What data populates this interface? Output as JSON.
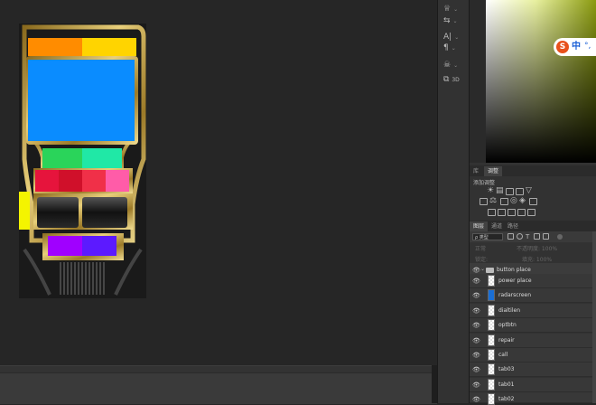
{
  "tool_strip": {
    "tools": [
      {
        "icon": "brush-settings-icon",
        "glyph": "♕"
      },
      {
        "icon": "clone-source-icon",
        "glyph": "⇆"
      },
      {
        "icon": "character-icon",
        "glyph": "A|"
      },
      {
        "icon": "paragraph-icon",
        "glyph": "¶"
      },
      {
        "icon": "properties-icon",
        "glyph": "☠"
      },
      {
        "icon": "3d-icon",
        "glyph": "⧉",
        "label": "3D"
      }
    ]
  },
  "ime": {
    "logo": "S",
    "lang": "中",
    "punct": "°,"
  },
  "adjustments_panel": {
    "tabs": [
      {
        "label": "库",
        "active": false
      },
      {
        "label": "调整",
        "active": true
      }
    ],
    "add_label": "添加调整"
  },
  "layers_panel": {
    "tabs": [
      {
        "label": "图层",
        "active": true
      },
      {
        "label": "通道",
        "active": false
      },
      {
        "label": "路径",
        "active": false
      }
    ],
    "filter_label": "ρ 类型",
    "mode_label": "正常",
    "opacity_label": "不透明度: 100%",
    "lock_label": "锁定:",
    "fill_label": "填充: 100%",
    "layers": [
      {
        "name": "button place",
        "type": "group"
      },
      {
        "name": "power place",
        "type": "layer"
      },
      {
        "name": "radarscreen",
        "type": "layer",
        "thumb_color": "#1a6fd6"
      },
      {
        "name": "dialtilen",
        "type": "layer"
      },
      {
        "name": "optbtn",
        "type": "layer"
      },
      {
        "name": "repair",
        "type": "layer"
      },
      {
        "name": "call",
        "type": "layer"
      },
      {
        "name": "tab03",
        "type": "layer"
      },
      {
        "name": "tab01",
        "type": "layer"
      },
      {
        "name": "tab02",
        "type": "layer"
      }
    ]
  },
  "colors": {
    "orange": "#ff8c00",
    "yellow": "#ffd400",
    "blue": "#0a8cff",
    "green": "#2ad45a",
    "teal": "#20e8a6",
    "red1": "#e6143c",
    "red2": "#d0102a",
    "red3": "#f03048",
    "pink": "#ff5ca8",
    "lime": "#f4f400",
    "purple": "#a000ff",
    "violet": "#5c1aff",
    "gold": "#c9a64a"
  }
}
